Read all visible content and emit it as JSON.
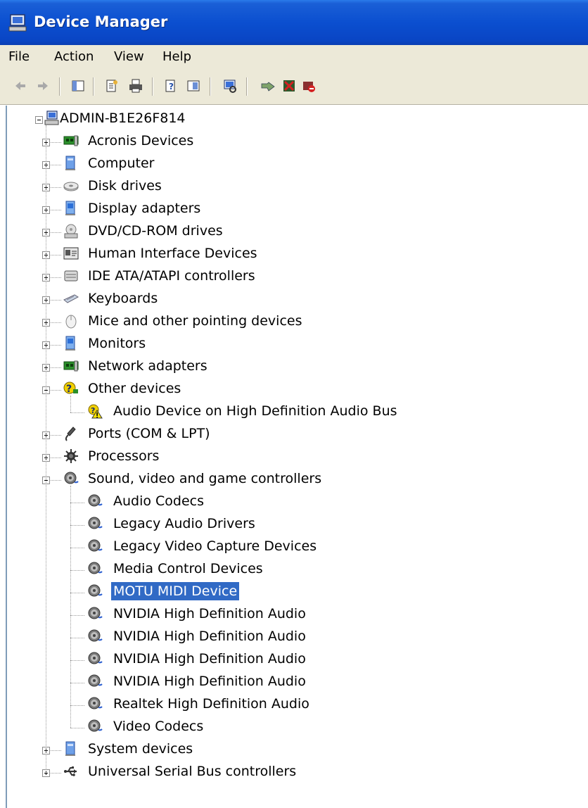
{
  "window": {
    "title": "Device Manager"
  },
  "menu": [
    "File",
    "Action",
    "View",
    "Help"
  ],
  "toolbar_icons": [
    "back-icon",
    "forward-icon",
    "show-hide-tree-icon",
    "properties-icon",
    "print-icon",
    "help-icon",
    "view-icon",
    "scan-hardware-icon",
    "update-driver-icon",
    "uninstall-icon",
    "disable-icon"
  ],
  "tree": {
    "root": "ADMIN-B1E26F814",
    "categories": [
      {
        "label": "Acronis Devices",
        "icon": "network-card-icon",
        "expanded": false
      },
      {
        "label": "Computer",
        "icon": "computer-icon",
        "expanded": false
      },
      {
        "label": "Disk drives",
        "icon": "disk-drive-icon",
        "expanded": false
      },
      {
        "label": "Display adapters",
        "icon": "display-icon",
        "expanded": false
      },
      {
        "label": "DVD/CD-ROM drives",
        "icon": "cdrom-icon",
        "expanded": false
      },
      {
        "label": "Human Interface Devices",
        "icon": "hid-icon",
        "expanded": false
      },
      {
        "label": "IDE ATA/ATAPI controllers",
        "icon": "ide-controller-icon",
        "expanded": false
      },
      {
        "label": "Keyboards",
        "icon": "keyboard-icon",
        "expanded": false
      },
      {
        "label": "Mice and other pointing devices",
        "icon": "mouse-icon",
        "expanded": false
      },
      {
        "label": "Monitors",
        "icon": "monitor-icon",
        "expanded": false
      },
      {
        "label": "Network adapters",
        "icon": "network-card-icon",
        "expanded": false
      },
      {
        "label": "Other devices",
        "icon": "unknown-device-icon",
        "expanded": true,
        "children": [
          {
            "label": "Audio Device on High Definition Audio Bus",
            "icon": "warning-device-icon"
          }
        ]
      },
      {
        "label": "Ports (COM & LPT)",
        "icon": "port-icon",
        "expanded": false
      },
      {
        "label": "Processors",
        "icon": "processor-icon",
        "expanded": false
      },
      {
        "label": "Sound, video and game controllers",
        "icon": "speaker-icon",
        "expanded": true,
        "children": [
          {
            "label": "Audio Codecs",
            "icon": "speaker-icon"
          },
          {
            "label": "Legacy Audio Drivers",
            "icon": "speaker-icon"
          },
          {
            "label": "Legacy Video Capture Devices",
            "icon": "speaker-icon"
          },
          {
            "label": "Media Control Devices",
            "icon": "speaker-icon"
          },
          {
            "label": "MOTU MIDI Device",
            "icon": "speaker-icon",
            "selected": true
          },
          {
            "label": "NVIDIA High Definition Audio",
            "icon": "speaker-icon"
          },
          {
            "label": "NVIDIA High Definition Audio",
            "icon": "speaker-icon"
          },
          {
            "label": "NVIDIA High Definition Audio",
            "icon": "speaker-icon"
          },
          {
            "label": "NVIDIA High Definition Audio",
            "icon": "speaker-icon"
          },
          {
            "label": "Realtek High Definition Audio",
            "icon": "speaker-icon"
          },
          {
            "label": "Video Codecs",
            "icon": "speaker-icon"
          }
        ]
      },
      {
        "label": "System devices",
        "icon": "computer-icon",
        "expanded": false
      },
      {
        "label": "Universal Serial Bus controllers",
        "icon": "usb-icon",
        "expanded": false
      }
    ]
  },
  "colors": {
    "titlebar": "#0b4fd0",
    "selection": "#316ac5",
    "chrome": "#ece9d8"
  }
}
